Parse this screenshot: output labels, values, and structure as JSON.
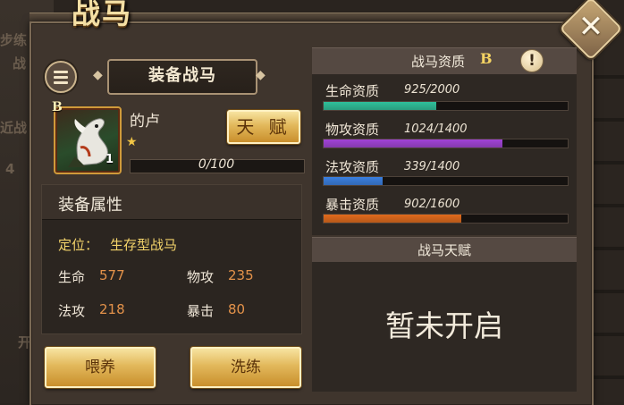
{
  "window": {
    "title": "战马",
    "close_label": "✕"
  },
  "background_fragments": [
    "步练",
    "战",
    "近战",
    "4",
    "开"
  ],
  "left_panel": {
    "section_title": "装备战马",
    "horse": {
      "grade": "B",
      "name": "的卢",
      "level": "1",
      "stars": "★",
      "stars_count": 1,
      "exp_text": "0/100",
      "exp_fraction": 0.0
    },
    "talent_button": "天 赋",
    "attributes": {
      "title": "装备属性",
      "position_label": "定位：",
      "position_value": "生存型战马",
      "stats": [
        {
          "label": "生命",
          "value": "577"
        },
        {
          "label": "物攻",
          "value": "235"
        },
        {
          "label": "法攻",
          "value": "218"
        },
        {
          "label": "暴击",
          "value": "80"
        }
      ]
    },
    "feed_button": "喂养",
    "refine_button": "洗练"
  },
  "aptitude": {
    "title": "战马资质",
    "grade": "B",
    "info_icon": "!",
    "items": [
      {
        "label": "生命资质",
        "value": "925/2000",
        "fraction": 0.4625,
        "color": "#2fbf9a"
      },
      {
        "label": "物攻资质",
        "value": "1024/1400",
        "fraction": 0.7314,
        "color": "#a043d6"
      },
      {
        "label": "法攻资质",
        "value": "339/1400",
        "fraction": 0.2421,
        "color": "#3a7fe0"
      },
      {
        "label": "暴击资质",
        "value": "902/1600",
        "fraction": 0.5638,
        "color": "#e06a1c"
      }
    ]
  },
  "horse_talent": {
    "title": "战马天赋",
    "empty_text": "暂未开启"
  },
  "colors": {
    "accent_gold": "#f5d463",
    "panel_bg": "#3f352d"
  }
}
